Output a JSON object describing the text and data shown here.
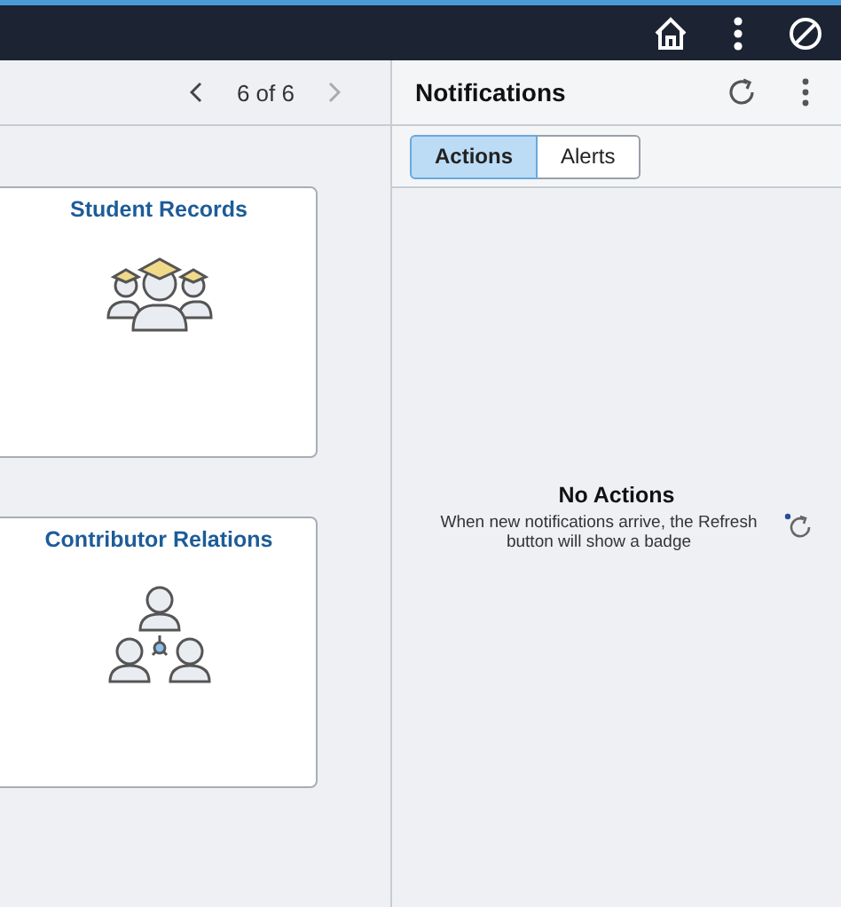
{
  "pager": {
    "text": "6 of 6"
  },
  "tiles": [
    {
      "title": "Student Records",
      "kind": "graduates"
    },
    {
      "title": "Contributor Relations",
      "kind": "network"
    }
  ],
  "notifications": {
    "title": "Notifications",
    "tabs": [
      {
        "label": "Actions",
        "selected": true
      },
      {
        "label": "Alerts",
        "selected": false
      }
    ],
    "empty_title": "No Actions",
    "empty_message": "When new notifications arrive, the Refresh button will show a badge"
  }
}
